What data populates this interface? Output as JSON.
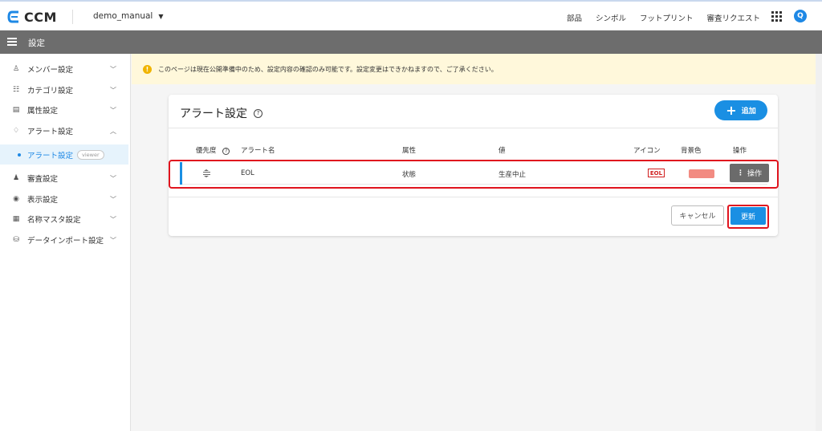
{
  "app": {
    "name": "CCM",
    "project": "demo_manual"
  },
  "nav": [
    "部品",
    "シンボル",
    "フットプリント",
    "審査リクエスト"
  ],
  "avatar_initial": "Q",
  "subheader": {
    "title": "設定"
  },
  "sidebar": {
    "items": [
      {
        "label": "メンバー設定",
        "icon": "user-icon"
      },
      {
        "label": "カテゴリ設定",
        "icon": "list-icon"
      },
      {
        "label": "属性設定",
        "icon": "document-icon"
      },
      {
        "label": "アラート設定",
        "icon": "bell-icon"
      },
      {
        "label": "審査設定",
        "icon": "stamp-icon"
      },
      {
        "label": "表示設定",
        "icon": "eye-icon"
      },
      {
        "label": "名称マスタ設定",
        "icon": "table-icon"
      },
      {
        "label": "データインポート設定",
        "icon": "database-icon"
      }
    ],
    "sub_item": {
      "label": "アラート設定",
      "badge": "viewer"
    }
  },
  "notice": {
    "text": "このページは現在公開準備中のため、設定内容の確認のみ可能です。設定変更はできかねますので、ご了承ください。"
  },
  "card": {
    "title": "アラート設定",
    "add_label": "追加",
    "columns": {
      "priority": "優先度",
      "name": "アラート名",
      "attribute": "属性",
      "value": "値",
      "icon": "アイコン",
      "bgcolor": "背景色",
      "action": "操作"
    },
    "rows": [
      {
        "name": "EOL",
        "attribute": "状態",
        "value": "生産中止",
        "icon_text": "EOL",
        "bgcolor": "#f28b82",
        "action_label": "操作"
      }
    ],
    "cancel_label": "キャンセル",
    "update_label": "更新"
  },
  "colors": {
    "accent": "#1a8fe3",
    "highlight": "#e0141e",
    "notice_bg": "#fff8db"
  }
}
